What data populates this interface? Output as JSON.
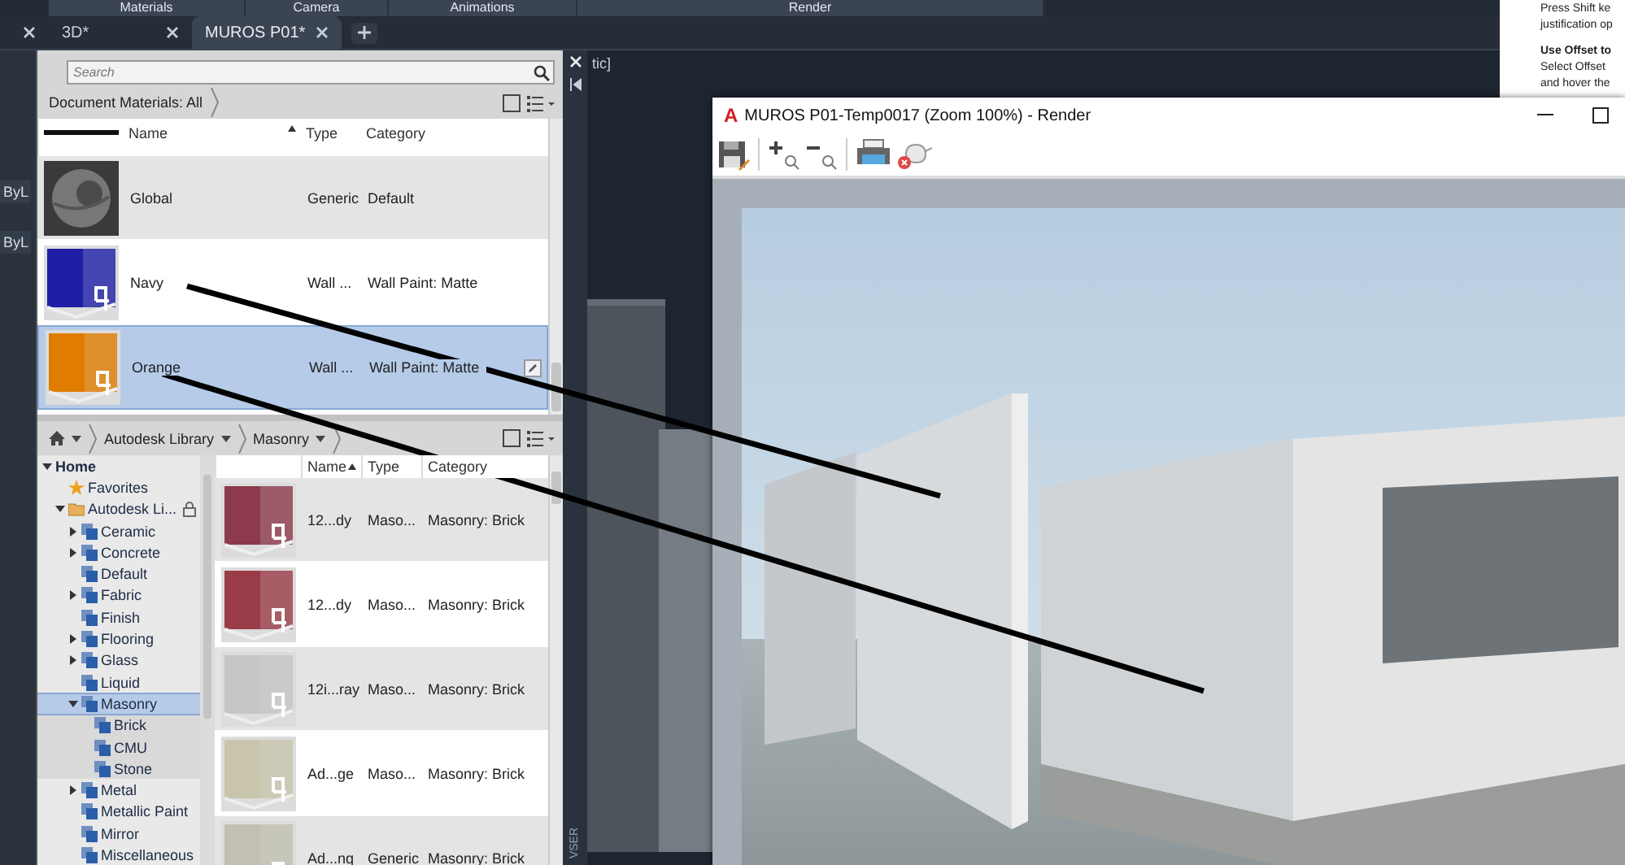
{
  "ribbon": {
    "panels": [
      "Materials",
      "Camera",
      "Animations",
      "Render"
    ]
  },
  "tabs": [
    {
      "selected": false
    },
    {
      "label": "3D*",
      "selected": false
    },
    {
      "label": "MUROS P01*",
      "selected": true
    }
  ],
  "properties_stub": {
    "values": [
      "ByL",
      "ByL"
    ]
  },
  "materials_browser": {
    "search": {
      "placeholder": "Search"
    },
    "document_materials": {
      "title": "Document Materials: All",
      "columns": [
        {
          "label": "Name",
          "sorted": true
        },
        {
          "label": "Type",
          "sorted": false
        },
        {
          "label": "Category",
          "sorted": false
        }
      ],
      "rows": [
        {
          "name": "Global",
          "type": "Generic",
          "category": "Default",
          "kind": "sphere",
          "selected": false
        },
        {
          "name": "Navy",
          "type": "Wall ...",
          "category": "Wall Paint: Matte",
          "kind": "wall",
          "color": "#1f1fa6",
          "selected": false
        },
        {
          "name": "Orange",
          "type": "Wall ...",
          "category": "Wall Paint: Matte",
          "kind": "wall",
          "color": "#e07c00",
          "selected": true
        }
      ]
    },
    "library": {
      "breadcrumb": [
        "Autodesk Library",
        "Masonry"
      ],
      "tree": [
        {
          "label": "Home",
          "kind": "home",
          "expanded": true,
          "selected": false,
          "children": [
            {
              "label": "Favorites",
              "kind": "favorites",
              "selected": false
            },
            {
              "label": "Autodesk Li...",
              "kind": "library",
              "expanded": true,
              "locked": true,
              "selected": false,
              "children": [
                {
                  "label": "Ceramic",
                  "kind": "category",
                  "expanded": false,
                  "selected": false
                },
                {
                  "label": "Concrete",
                  "kind": "category",
                  "expanded": false,
                  "selected": false
                },
                {
                  "label": "Default",
                  "kind": "category",
                  "selected": false
                },
                {
                  "label": "Fabric",
                  "kind": "category",
                  "expanded": false,
                  "selected": false
                },
                {
                  "label": "Finish",
                  "kind": "category",
                  "selected": false
                },
                {
                  "label": "Flooring",
                  "kind": "category",
                  "expanded": false,
                  "selected": false
                },
                {
                  "label": "Glass",
                  "kind": "category",
                  "expanded": false,
                  "selected": false
                },
                {
                  "label": "Liquid",
                  "kind": "category",
                  "selected": false
                },
                {
                  "label": "Masonry",
                  "kind": "category",
                  "expanded": true,
                  "selected": true,
                  "children": [
                    {
                      "label": "Brick",
                      "kind": "category",
                      "selected": false
                    },
                    {
                      "label": "CMU",
                      "kind": "category",
                      "selected": false
                    },
                    {
                      "label": "Stone",
                      "kind": "category",
                      "selected": false
                    }
                  ]
                },
                {
                  "label": "Metal",
                  "kind": "category",
                  "expanded": false,
                  "selected": false
                },
                {
                  "label": "Metallic Paint",
                  "kind": "category",
                  "selected": false
                },
                {
                  "label": "Mirror",
                  "kind": "category",
                  "selected": false
                },
                {
                  "label": "Miscellaneous",
                  "kind": "category",
                  "selected": false
                }
              ]
            }
          ]
        }
      ],
      "columns": [
        {
          "label": "Name",
          "sorted": true
        },
        {
          "label": "Type",
          "sorted": false
        },
        {
          "label": "Category",
          "sorted": false
        }
      ],
      "rows": [
        {
          "name": "12...dy",
          "type": "Maso...",
          "category": "Masonry: Brick",
          "color": "#8c3a4c"
        },
        {
          "name": "12...dy",
          "type": "Maso...",
          "category": "Masonry: Brick",
          "color": "#9a3c48"
        },
        {
          "name": "12i...ray",
          "type": "Maso...",
          "category": "Masonry: Brick",
          "color": "#c6c6c6"
        },
        {
          "name": "Ad...ge",
          "type": "Maso...",
          "category": "Masonry: Brick",
          "color": "#c8c5ac"
        },
        {
          "name": "Ad...nq",
          "type": "Generic",
          "category": "Masonry: Brick",
          "color": "#c2c0b2"
        }
      ]
    }
  },
  "palette_strip": {
    "label": "VSER"
  },
  "viewport": {
    "label": "tic]"
  },
  "render_window": {
    "logo": "A",
    "title": "MUROS P01-Temp0017 (Zoom 100%) - Render"
  },
  "tooltip": {
    "lines": [
      {
        "text": "Press Shift ke",
        "kind": "body"
      },
      {
        "text": "justification op",
        "kind": "body"
      },
      {
        "text": "Use Offset to",
        "kind": "heading"
      },
      {
        "text": "Select Offset",
        "kind": "body"
      },
      {
        "text": "and hover the",
        "kind": "body"
      }
    ]
  }
}
